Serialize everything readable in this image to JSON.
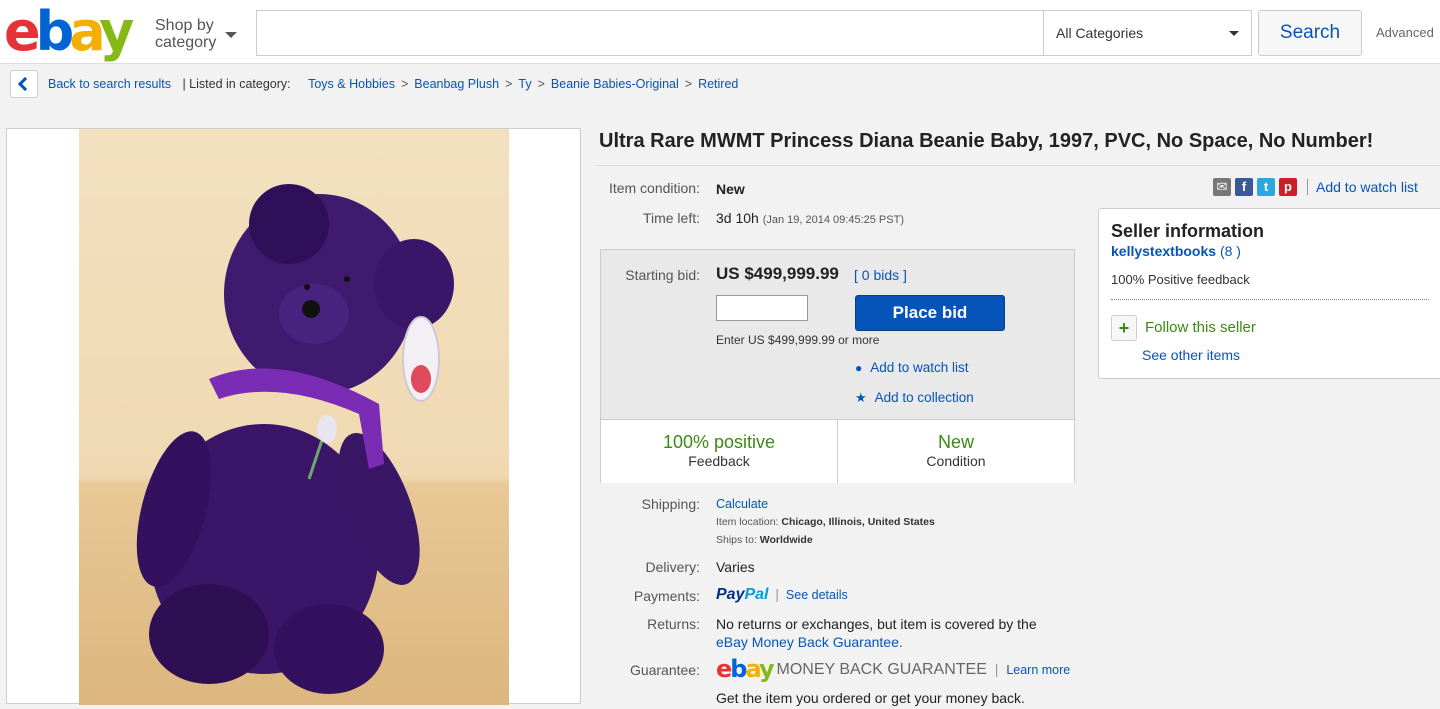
{
  "header": {
    "logo_letters": [
      "e",
      "b",
      "a",
      "y"
    ],
    "shop_by_line1": "Shop by",
    "shop_by_line2": "category",
    "search_value": "",
    "category_select": "All Categories",
    "search_button": "Search",
    "advanced_link": "Advanced"
  },
  "breadcrumb": {
    "back_label": "Back to search results",
    "listed_in": "| Listed in category:",
    "items": [
      "Toys & Hobbies",
      "Beanbag Plush",
      "Ty",
      "Beanie Babies-Original",
      "Retired"
    ]
  },
  "listing": {
    "title": "Ultra Rare MWMT Princess Diana Beanie Baby, 1997, PVC, No Space, No Number!",
    "condition_label": "Item condition:",
    "condition_value": "New",
    "time_left_label": "Time left:",
    "time_left_value": "3d 10h",
    "time_left_detail": "(Jan 19, 2014   09:45:25 PST)",
    "share": {
      "icons": [
        "email-icon",
        "facebook-icon",
        "twitter-icon",
        "pinterest-icon"
      ],
      "watch_link": "Add to watch list"
    }
  },
  "bid": {
    "starting_bid_label": "Starting bid:",
    "starting_bid_value": "US $499,999.99",
    "bids_link": "[ 0 bids ]",
    "bid_input_value": "",
    "place_bid_button": "Place bid",
    "enter_hint": "Enter US $499,999.99 or more",
    "add_watch": "Add to watch list",
    "add_collection": "Add to collection",
    "feedback_big": "100% positive",
    "feedback_sub": "Feedback",
    "condition_big": "New",
    "condition_sub": "Condition"
  },
  "details": {
    "shipping_label": "Shipping:",
    "shipping_value": "Calculate",
    "item_location_label": "Item location:",
    "item_location_value": "Chicago, Illinois, United States",
    "ships_to_label": "Ships to:",
    "ships_to_value": "Worldwide",
    "delivery_label": "Delivery:",
    "delivery_value": "Varies",
    "payments_label": "Payments:",
    "paypal_part1": "Pay",
    "paypal_part2": "Pal",
    "see_details": "See details",
    "returns_label": "Returns:",
    "returns_line1": "No returns or exchanges, but item is covered by the",
    "returns_line2": "eBay Money Back Guarantee.",
    "guarantee_label": "Guarantee:",
    "guarantee_logo_letters": [
      "e",
      "b",
      "a",
      "y"
    ],
    "guarantee_text": "MONEY BACK GUARANTEE",
    "learn_more": "Learn more",
    "guarantee_sub": "Get the item you ordered or get your money back."
  },
  "seller": {
    "heading": "Seller information",
    "name": "kellystextbooks",
    "score": "(8 )",
    "feedback": "100% Positive feedback",
    "follow_plus": "+",
    "follow": "Follow this seller",
    "see_other": "See other items"
  }
}
